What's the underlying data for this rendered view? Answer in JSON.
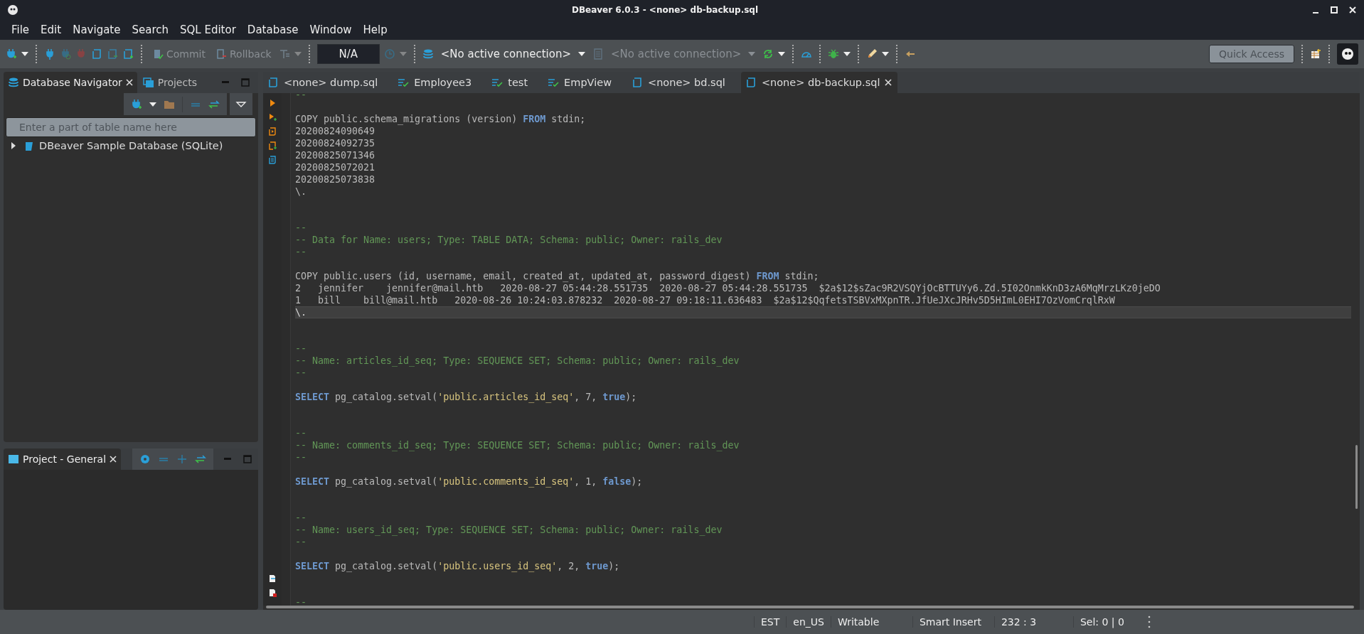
{
  "window": {
    "title": "DBeaver 6.0.3 - <none> db-backup.sql"
  },
  "menu": [
    "File",
    "Edit",
    "Navigate",
    "Search",
    "SQL Editor",
    "Database",
    "Window",
    "Help"
  ],
  "toolbar": {
    "commit": {
      "label": "Commit",
      "disabled": true
    },
    "rollback": {
      "label": "Rollback",
      "disabled": true
    },
    "transaction_mode": "N/A",
    "connection": {
      "label": "<No active connection>",
      "disabled": false
    },
    "schema": {
      "label": "<No active connection>",
      "disabled": true
    },
    "quick_access": {
      "placeholder": "Quick Access"
    }
  },
  "navigator": {
    "tabs": [
      {
        "label": "Database Navigator",
        "selected": true
      },
      {
        "label": "Projects",
        "selected": false
      }
    ],
    "filter": {
      "placeholder": "Enter a part of table name here"
    },
    "tree": [
      {
        "label": "DBeaver Sample Database (SQLite)",
        "expanded": false
      }
    ]
  },
  "project_panel": {
    "tabs": [
      {
        "label": "Project - General",
        "selected": true
      }
    ]
  },
  "editor": {
    "tabs": [
      {
        "label": "<none> dump.sql",
        "kind": "script",
        "selected": false
      },
      {
        "label": "Employee3",
        "kind": "view",
        "selected": false
      },
      {
        "label": "test",
        "kind": "view",
        "selected": false
      },
      {
        "label": "EmpView",
        "kind": "view",
        "selected": false
      },
      {
        "label": "<none> bd.sql",
        "kind": "script",
        "selected": false
      },
      {
        "label": "<none> db-backup.sql",
        "kind": "script",
        "selected": true
      }
    ],
    "lines": [
      {
        "current": false,
        "tokens": [
          {
            "kind": "comment",
            "text": "--"
          }
        ]
      },
      {
        "current": false
      },
      {
        "current": false,
        "tokens": [
          {
            "kind": "plain",
            "text": "COPY public.schema_migrations (version) "
          },
          {
            "kind": "keyword",
            "text": "FROM"
          },
          {
            "kind": "plain",
            "text": " stdin;"
          }
        ]
      },
      {
        "current": false,
        "tokens": [
          {
            "kind": "plain",
            "text": "20200824090649"
          }
        ]
      },
      {
        "current": false,
        "tokens": [
          {
            "kind": "plain",
            "text": "20200824092735"
          }
        ]
      },
      {
        "current": false,
        "tokens": [
          {
            "kind": "plain",
            "text": "20200825071346"
          }
        ]
      },
      {
        "current": false,
        "tokens": [
          {
            "kind": "plain",
            "text": "20200825072021"
          }
        ]
      },
      {
        "current": false,
        "tokens": [
          {
            "kind": "plain",
            "text": "20200825073838"
          }
        ]
      },
      {
        "current": false,
        "tokens": [
          {
            "kind": "plain",
            "text": "\\."
          }
        ]
      },
      {
        "current": false
      },
      {
        "current": false
      },
      {
        "current": false,
        "tokens": [
          {
            "kind": "comment",
            "text": "--"
          }
        ]
      },
      {
        "current": false,
        "tokens": [
          {
            "kind": "comment",
            "text": "-- Data for Name: users; Type: TABLE DATA; Schema: public; Owner: rails_dev"
          }
        ]
      },
      {
        "current": false,
        "tokens": [
          {
            "kind": "comment",
            "text": "--"
          }
        ]
      },
      {
        "current": false
      },
      {
        "current": false,
        "tokens": [
          {
            "kind": "plain",
            "text": "COPY public.users (id, username, email, created_at, updated_at, password_digest) "
          },
          {
            "kind": "keyword",
            "text": "FROM"
          },
          {
            "kind": "plain",
            "text": " stdin;"
          }
        ]
      },
      {
        "current": false,
        "tokens": [
          {
            "kind": "plain",
            "text": "2   jennifer    jennifer@mail.htb   2020-08-27 05:44:28.551735  2020-08-27 05:44:28.551735  $2a$12$sZac9R2VSQYjOcBTTUYy6.Zd.5I02OnmkKnD3zA6MqMrzLKz0jeDO"
          }
        ]
      },
      {
        "current": false,
        "tokens": [
          {
            "kind": "plain",
            "text": "1   bill    bill@mail.htb   2020-08-26 10:24:03.878232  2020-08-27 09:18:11.636483  $2a$12$QqfetsTSBVxMXpnTR.JfUeJXcJRHv5D5HImL0EHI7OzVomCrqlRxW"
          }
        ]
      },
      {
        "current": true,
        "tokens": [
          {
            "kind": "plain",
            "text": "\\."
          }
        ]
      },
      {
        "current": false
      },
      {
        "current": false
      },
      {
        "current": false,
        "tokens": [
          {
            "kind": "comment",
            "text": "--"
          }
        ]
      },
      {
        "current": false,
        "tokens": [
          {
            "kind": "comment",
            "text": "-- Name: articles_id_seq; Type: SEQUENCE SET; Schema: public; Owner: rails_dev"
          }
        ]
      },
      {
        "current": false,
        "tokens": [
          {
            "kind": "comment",
            "text": "--"
          }
        ]
      },
      {
        "current": false
      },
      {
        "current": false,
        "tokens": [
          {
            "kind": "keyword",
            "text": "SELECT"
          },
          {
            "kind": "plain",
            "text": " pg_catalog.setval("
          },
          {
            "kind": "string",
            "text": "'public.articles_id_seq'"
          },
          {
            "kind": "plain",
            "text": ", 7, "
          },
          {
            "kind": "keyword",
            "text": "true"
          },
          {
            "kind": "plain",
            "text": ");"
          }
        ]
      },
      {
        "current": false
      },
      {
        "current": false
      },
      {
        "current": false,
        "tokens": [
          {
            "kind": "comment",
            "text": "--"
          }
        ]
      },
      {
        "current": false,
        "tokens": [
          {
            "kind": "comment",
            "text": "-- Name: comments_id_seq; Type: SEQUENCE SET; Schema: public; Owner: rails_dev"
          }
        ]
      },
      {
        "current": false,
        "tokens": [
          {
            "kind": "comment",
            "text": "--"
          }
        ]
      },
      {
        "current": false
      },
      {
        "current": false,
        "tokens": [
          {
            "kind": "keyword",
            "text": "SELECT"
          },
          {
            "kind": "plain",
            "text": " pg_catalog.setval("
          },
          {
            "kind": "string",
            "text": "'public.comments_id_seq'"
          },
          {
            "kind": "plain",
            "text": ", 1, "
          },
          {
            "kind": "keyword",
            "text": "false"
          },
          {
            "kind": "plain",
            "text": ");"
          }
        ]
      },
      {
        "current": false
      },
      {
        "current": false
      },
      {
        "current": false,
        "tokens": [
          {
            "kind": "comment",
            "text": "--"
          }
        ]
      },
      {
        "current": false,
        "tokens": [
          {
            "kind": "comment",
            "text": "-- Name: users_id_seq; Type: SEQUENCE SET; Schema: public; Owner: rails_dev"
          }
        ]
      },
      {
        "current": false,
        "tokens": [
          {
            "kind": "comment",
            "text": "--"
          }
        ]
      },
      {
        "current": false
      },
      {
        "current": false,
        "tokens": [
          {
            "kind": "keyword",
            "text": "SELECT"
          },
          {
            "kind": "plain",
            "text": " pg_catalog.setval("
          },
          {
            "kind": "string",
            "text": "'public.users_id_seq'"
          },
          {
            "kind": "plain",
            "text": ", 2, "
          },
          {
            "kind": "keyword",
            "text": "true"
          },
          {
            "kind": "plain",
            "text": ");"
          }
        ]
      },
      {
        "current": false
      },
      {
        "current": false
      },
      {
        "current": false,
        "tokens": [
          {
            "kind": "comment",
            "text": "--"
          }
        ]
      }
    ]
  },
  "status_bar": [
    "EST",
    "en_US",
    "Writable",
    "Smart Insert",
    "232 : 3",
    "Sel: 0 | 0"
  ]
}
